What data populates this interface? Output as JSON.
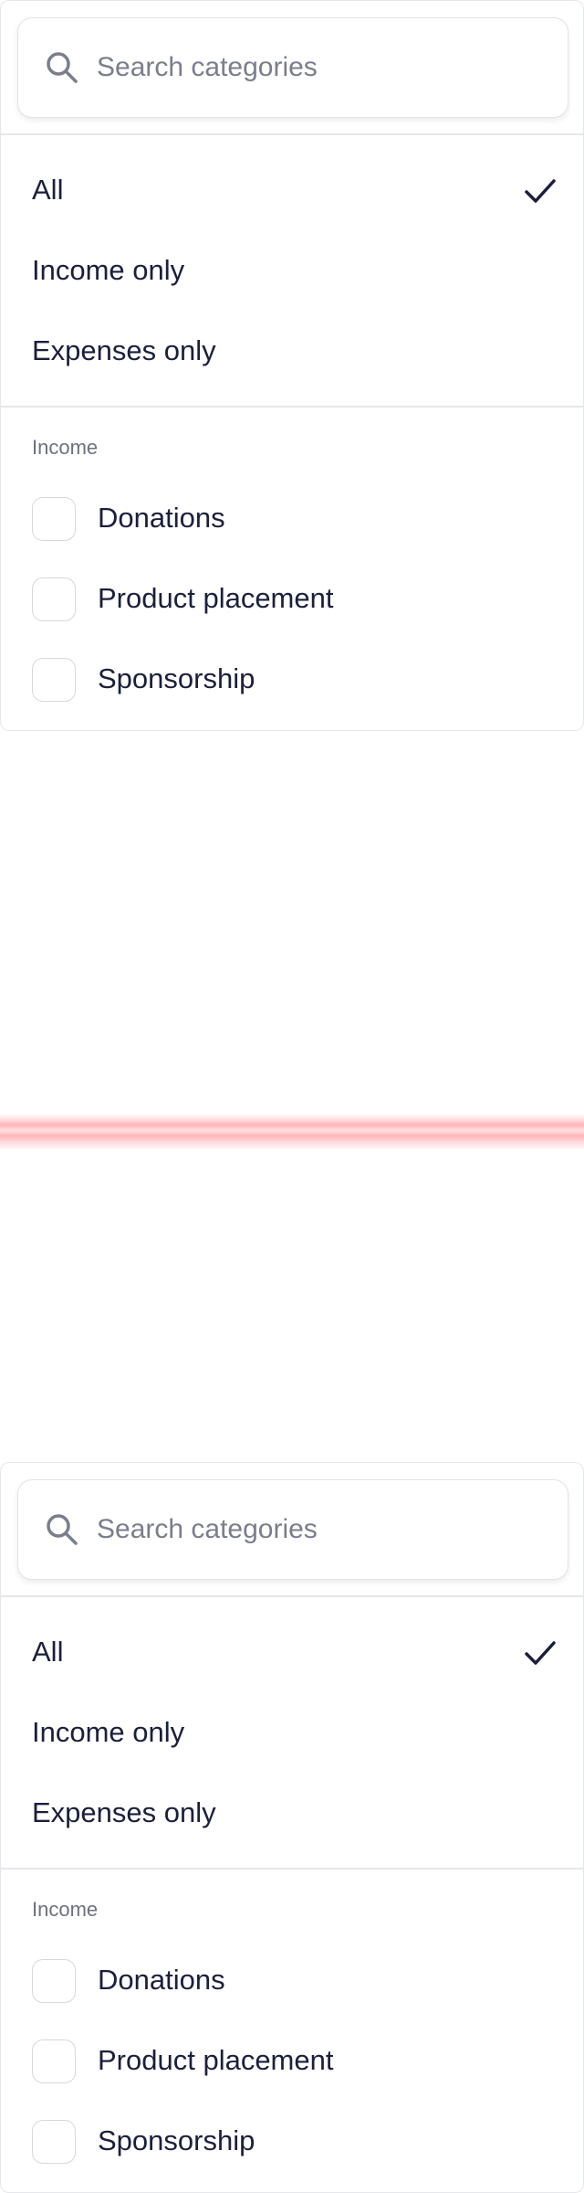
{
  "dropdown": {
    "search": {
      "placeholder": "Search categories",
      "value": "",
      "icon": "search-icon"
    },
    "options": [
      {
        "label": "All",
        "selected": true
      },
      {
        "label": "Income only",
        "selected": false
      },
      {
        "label": "Expenses only",
        "selected": false
      }
    ],
    "section": {
      "label": "Income",
      "items": [
        {
          "label": "Donations",
          "checked": false
        },
        {
          "label": "Product placement",
          "checked": false
        },
        {
          "label": "Sponsorship",
          "checked": false
        }
      ]
    }
  },
  "colors": {
    "text": "#1b1f3b",
    "muted": "#6d7180",
    "border": "#e6e7ea",
    "marker": "#ff7882"
  }
}
